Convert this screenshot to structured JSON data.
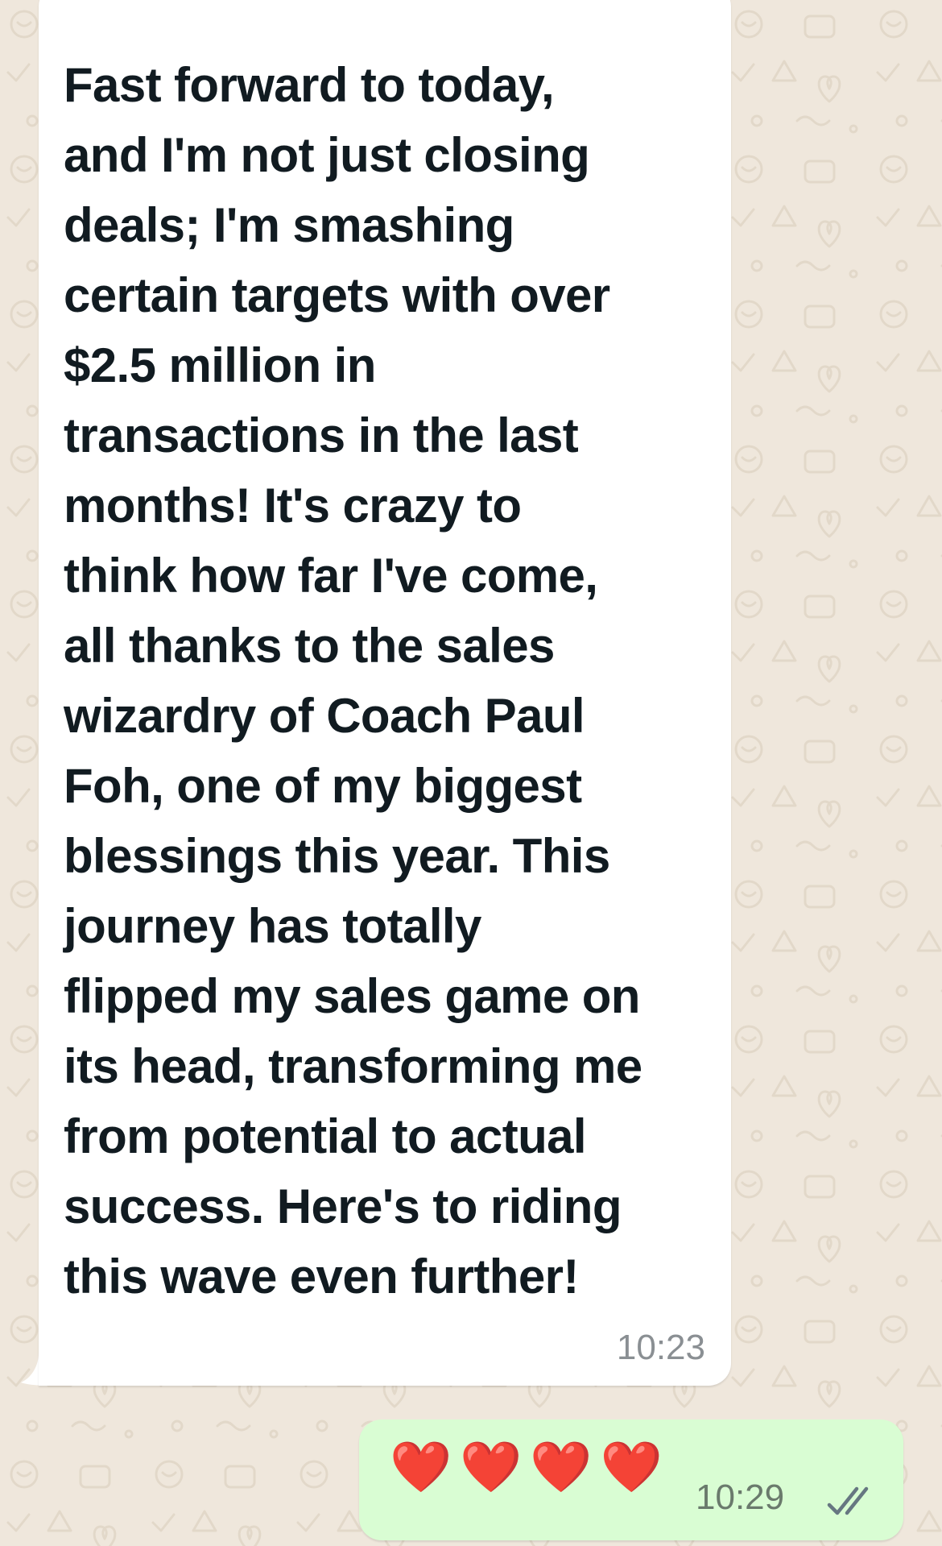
{
  "messages": [
    {
      "direction": "incoming",
      "text": "Fast forward to today,\nand I'm not just closing\ndeals; I'm smashing\ncertain targets with over\n$2.5 million in\ntransactions in the last\nmonths! It's crazy to\nthink how far I've come,\nall thanks to the sales\nwizardry of Coach Paul\nFoh, one of my biggest\nblessings this year. This\njourney has totally\nflipped my sales game on\nits head, transforming me\nfrom potential to actual\nsuccess. Here's to riding\nthis wave even further!",
      "time": "10:23"
    },
    {
      "direction": "outgoing",
      "text": "❤️❤️❤️❤️",
      "time": "10:29",
      "status_icon": "double-check-icon"
    }
  ],
  "colors": {
    "wallpaper": "#efe7dc",
    "incoming_bubble": "#ffffff",
    "outgoing_bubble": "#d9fdd3",
    "text": "#111b21",
    "timestamp": "#8a8f93",
    "heart": "#e0202c"
  }
}
